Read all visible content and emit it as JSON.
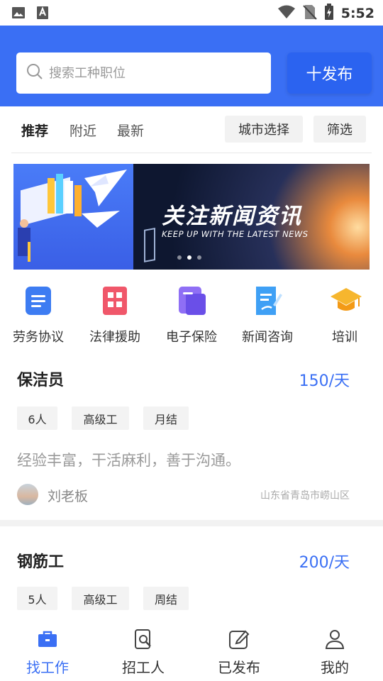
{
  "status_bar": {
    "time": "5:52"
  },
  "search": {
    "placeholder": "搜索工种职位",
    "value": ""
  },
  "header": {
    "publish_label": "十发布"
  },
  "tabs": [
    {
      "label": "推荐",
      "active": true
    },
    {
      "label": "附近",
      "active": false
    },
    {
      "label": "最新",
      "active": false
    }
  ],
  "filters": {
    "city_label": "城市选择",
    "filter_label": "筛选"
  },
  "banner": {
    "title": "关注新闻资讯",
    "subtitle": "KEEP UP WITH THE LATEST NEWS",
    "dots": 3,
    "active_dot": 1
  },
  "quick_links": [
    {
      "label": "劳务协议",
      "icon": "document-icon",
      "color": "#3d7cf2"
    },
    {
      "label": "法律援助",
      "icon": "building-icon",
      "color": "#f0576a"
    },
    {
      "label": "电子保险",
      "icon": "folder-icon",
      "color": "#7a5ef0"
    },
    {
      "label": "新闻咨询",
      "icon": "news-edit-icon",
      "color": "#3fa0f5"
    },
    {
      "label": "培训",
      "icon": "graduation-cap-icon",
      "color": "#f6b62e"
    }
  ],
  "jobs": [
    {
      "title": "保洁员",
      "wage": "150/天",
      "tags": [
        "6人",
        "高级工",
        "月结"
      ],
      "description": "经验丰富，干活麻利，善于沟通。",
      "owner": "刘老板",
      "location": "山东省青岛市崂山区"
    },
    {
      "title": "钢筋工",
      "wage": "200/天",
      "tags": [
        "5人",
        "高级工",
        "周结"
      ]
    }
  ],
  "bottom_nav": [
    {
      "label": "找工作",
      "icon": "briefcase-icon",
      "active": true
    },
    {
      "label": "招工人",
      "icon": "search-resume-icon",
      "active": false
    },
    {
      "label": "已发布",
      "icon": "edit-icon",
      "active": false
    },
    {
      "label": "我的",
      "icon": "user-icon",
      "active": false
    }
  ],
  "colors": {
    "primary": "#3a6ff4",
    "publish_button": "#2b63f0"
  }
}
